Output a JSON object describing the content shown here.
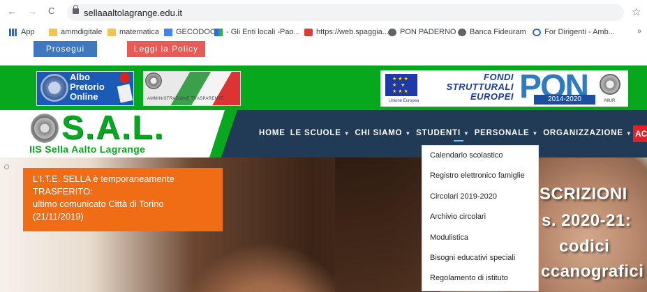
{
  "browser": {
    "back": "←",
    "forward": "→",
    "reload": "C",
    "url": "sellaaaltolagrange.edu.it",
    "star": "☆"
  },
  "bookmarks": [
    {
      "label": "App",
      "icon": "apps-icon"
    },
    {
      "label": "ammdigitale",
      "icon": "folder-icon"
    },
    {
      "label": "matematica",
      "icon": "folder-icon"
    },
    {
      "label": "GECODOC",
      "icon": "site-icon"
    },
    {
      "label": "- Gli Enti locali -Pao...",
      "icon": "site-icon"
    },
    {
      "label": "https://web.spaggia...",
      "icon": "spaggiari-icon"
    },
    {
      "label": "PON PADERNO",
      "icon": "globe-icon"
    },
    {
      "label": "Banca Fideuram",
      "icon": "globe-icon"
    },
    {
      "label": "For Dirigenti - Amb...",
      "icon": "dirigenti-icon"
    }
  ],
  "bookmarks_more": "»",
  "cookie": {
    "continue_label": "Prosegui",
    "policy_label": "Leggi la Policy"
  },
  "banner": {
    "albo": "Albo Pretorio Online",
    "amm": "AMMINISTRAZIONE TRASPARENTE",
    "fondi": "FONDI STRUTTURALI EUROPEI",
    "pon": "PON",
    "pon_years": "2014-2020",
    "ue": "Unione Europea",
    "miur": "MIUR"
  },
  "logo": {
    "title": "S.A.L.",
    "subtitle": "IIS Sella Aalto Lagrange"
  },
  "menu": [
    {
      "label": "HOME",
      "caret": false
    },
    {
      "label": "LE SCUOLE",
      "caret": true
    },
    {
      "label": "CHI SIAMO",
      "caret": true
    },
    {
      "label": "STUDENTI",
      "caret": true
    },
    {
      "label": "PERSONALE",
      "caret": true
    },
    {
      "label": "ORGANIZZAZIONE",
      "caret": true
    }
  ],
  "menu_cut": "AC",
  "dropdown": [
    "Calendario scolastico",
    "Registro elettronico famiglie",
    "Circolari 2019-2020",
    "Archivio circolari",
    "Modulistica",
    "Bisogni educativi speciali",
    "Regolamento di istituto"
  ],
  "notice": {
    "line1": "L'I.T.E. SELLA è temporaneamente",
    "line2": "TRASFERITO:",
    "line3": "ultimo comunicato Città di Torino",
    "line4": "(21/11/2019)"
  },
  "hero": {
    "line1": "SCRIZIONI",
    "line2": "s. 2020-21:",
    "line3": "codici",
    "line4": "ccanografici"
  }
}
